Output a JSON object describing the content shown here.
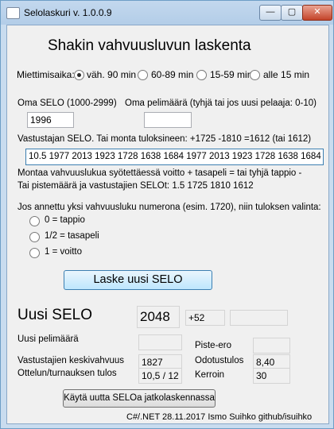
{
  "window": {
    "title": "Selolaskuri v. 1.0.0.9",
    "min": "—",
    "max": "▢",
    "close": "✕"
  },
  "heading": "Shakin vahvuusluvun laskenta",
  "time_control": {
    "label": "Miettimisaika:",
    "options": [
      "väh. 90 min",
      "60-89 min",
      "15-59 min",
      "alle 15 min"
    ],
    "selected": 0
  },
  "own": {
    "selo_label": "Oma SELO (1000-2999)",
    "selo_value": "1996",
    "games_label": "Oma pelimäärä (tyhjä tai jos uusi pelaaja: 0-10)",
    "games_value": ""
  },
  "opponents": {
    "label": "Vastustajan SELO. Tai monta tuloksineen: +1725 -1810 =1612 (tai 1612)",
    "value": "10.5 1977 2013 1923 1728 1638 1684 1977 2013 1923 1728 1638 1684",
    "help1": "Montaa vahvuuslukua syötettäessä voitto +   tasapeli = tai tyhjä   tappio -",
    "help2": "Tai pistemäärä ja vastustajien SELOt: 1.5 1725 1810 1612"
  },
  "result": {
    "label": "Jos annettu yksi vahvuusluku numerona (esim. 1720), niin tuloksen valinta:",
    "options": [
      "0 = tappio",
      "1/2 = tasapeli",
      "1 = voitto"
    ]
  },
  "calc_button": "Laske uusi SELO",
  "output": {
    "new_selo_label": "Uusi SELO",
    "new_selo_value": "2048",
    "change_value": "+52",
    "extra_value": "",
    "new_games_label": "Uusi pelimäärä",
    "new_games_value": "",
    "avg_label": "Vastustajien keskivahvuus",
    "avg_value": "1827",
    "score_label": "Ottelun/turnauksen tulos",
    "score_value": "10,5 / 12",
    "diff_label": "Piste-ero",
    "diff_value": "",
    "expected_label": "Odotustulos",
    "expected_value": "8,40",
    "factor_label": "Kerroin",
    "factor_value": "30"
  },
  "continue_button": "Käytä uutta SELOa jatkolaskennassa",
  "footer": "C#/.NET 28.11.2017 Ismo Suihko github/isuihko"
}
